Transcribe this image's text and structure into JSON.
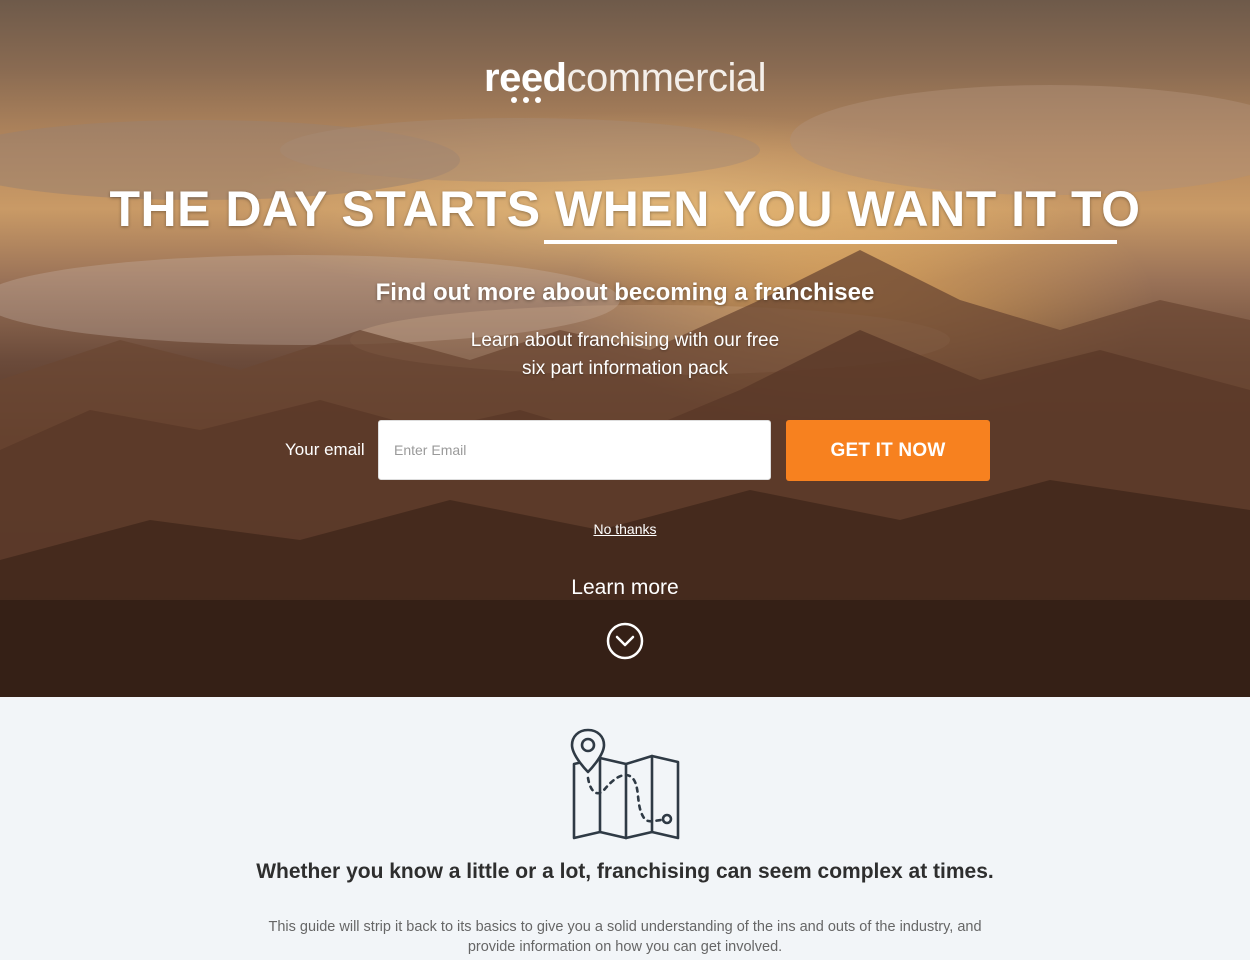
{
  "brand": {
    "logo_bold": "reed",
    "logo_light": "commercial"
  },
  "hero": {
    "headline": "THE DAY STARTS WHEN YOU WANT IT TO",
    "subhead": "Find out more about becoming a franchisee",
    "description_line1": "Learn about franchising with our free",
    "description_line2": "six part information pack"
  },
  "form": {
    "email_label": "Your email",
    "email_placeholder": "Enter Email",
    "email_value": "",
    "submit_label": "GET IT NOW"
  },
  "links": {
    "no_thanks": "No thanks",
    "learn_more": "Learn more"
  },
  "info": {
    "title": "Whether you know a little or a lot, franchising can seem complex at times.",
    "body": "This guide will strip it back to its basics to give you a solid understanding of the ins and outs of the industry, and provide information on how you can get involved."
  },
  "icons": {
    "scroll": "chevron-down-circle-icon",
    "map": "map-pin-route-icon"
  },
  "colors": {
    "accent": "#f7811f",
    "text_dark": "#2e2e2e",
    "text_muted": "#666666",
    "lower_bg": "#f2f5f8"
  }
}
